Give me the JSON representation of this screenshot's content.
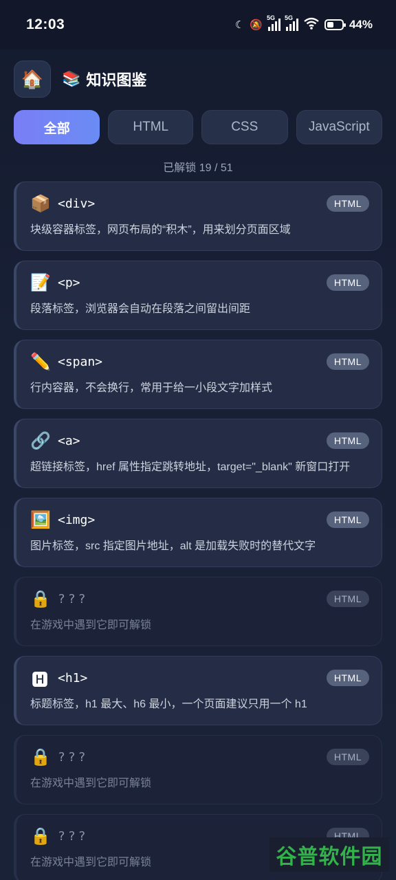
{
  "status_bar": {
    "time": "12:03",
    "network_label_1": "5G",
    "network_label_2": "5G",
    "battery_percent": "44%",
    "battery_level": 0.44
  },
  "header": {
    "home_icon": "🏠",
    "title_icon": "📚",
    "title": "知识图鉴"
  },
  "tabs": [
    {
      "label": "全部",
      "active": true
    },
    {
      "label": "HTML",
      "active": false
    },
    {
      "label": "CSS",
      "active": false
    },
    {
      "label": "JavaScript",
      "active": false
    }
  ],
  "unlock_status": "已解锁 19 / 51",
  "cards": [
    {
      "icon": "📦",
      "name": "<div>",
      "badge": "HTML",
      "desc": "块级容器标签，网页布局的“积木”，用来划分页面区域",
      "locked": false
    },
    {
      "icon": "📝",
      "name": "<p>",
      "badge": "HTML",
      "desc": "段落标签，浏览器会自动在段落之间留出间距",
      "locked": false
    },
    {
      "icon": "✏️",
      "name": "<span>",
      "badge": "HTML",
      "desc": "行内容器，不会换行，常用于给一小段文字加样式",
      "locked": false
    },
    {
      "icon": "🔗",
      "name": "<a>",
      "badge": "HTML",
      "desc": "超链接标签，href 属性指定跳转地址，target=\"_blank\" 新窗口打开",
      "locked": false
    },
    {
      "icon": "🖼️",
      "name": "<img>",
      "badge": "HTML",
      "desc": "图片标签，src 指定图片地址，alt 是加载失败时的替代文字",
      "locked": false
    },
    {
      "icon": "🔒",
      "name": "???",
      "badge": "HTML",
      "desc": "在游戏中遇到它即可解锁",
      "locked": true
    },
    {
      "icon": "🅷",
      "name": "<h1>",
      "badge": "HTML",
      "desc": "标题标签，h1 最大、h6 最小，一个页面建议只用一个 h1",
      "locked": false
    },
    {
      "icon": "🔒",
      "name": "???",
      "badge": "HTML",
      "desc": "在游戏中遇到它即可解锁",
      "locked": true
    },
    {
      "icon": "🔒",
      "name": "???",
      "badge": "HTML",
      "desc": "在游戏中遇到它即可解锁",
      "locked": true
    }
  ],
  "watermark": "谷普软件园"
}
